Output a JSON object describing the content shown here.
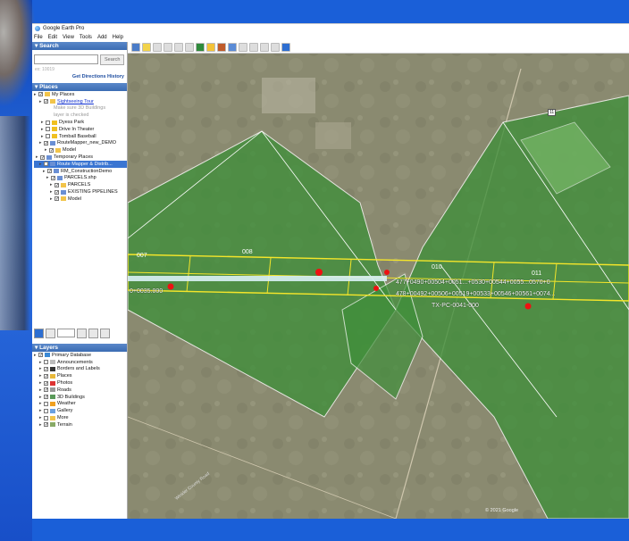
{
  "app": {
    "title": "Google Earth Pro"
  },
  "menu": [
    "File",
    "Edit",
    "View",
    "Tools",
    "Add",
    "Help"
  ],
  "search": {
    "header": "Search",
    "button": "Search",
    "hint": "ex: 10019",
    "get_directions": "Get Directions",
    "history": "History"
  },
  "places": {
    "header": "Places",
    "items": [
      {
        "label": "My Places",
        "checked": true,
        "icon": "folder-icon"
      },
      {
        "label": "Sightseeing Tour",
        "checked": true,
        "icon": "folder-icon",
        "link": true
      },
      {
        "label": "Make sure 3D Buildings",
        "sub": true
      },
      {
        "label": "layer is checked",
        "sub": true
      },
      {
        "label": "Dyess Park",
        "checked": false,
        "icon": "pin-icon"
      },
      {
        "label": "Drive In Theater",
        "checked": false,
        "icon": "pin-icon"
      },
      {
        "label": "Tomball Baseball",
        "checked": false,
        "icon": "pin-icon"
      },
      {
        "label": "RouteMapper_new_DEMO",
        "checked": true,
        "icon": "network-icon"
      },
      {
        "label": "Model",
        "checked": true,
        "icon": "folder-icon"
      },
      {
        "label": "Temporary Places",
        "checked": true,
        "icon": "network-icon"
      },
      {
        "label": "Route Mapper & Distrib...",
        "checked": true,
        "icon": "network-icon",
        "selected": true
      },
      {
        "label": "RM_ConstructionDemo",
        "checked": true,
        "icon": "network-icon"
      },
      {
        "label": "PARCELS.shp",
        "checked": true,
        "icon": "network-icon"
      },
      {
        "label": "PARCELS",
        "checked": true,
        "icon": "folder-icon"
      },
      {
        "label": "EXISTING PIPELINES",
        "checked": true,
        "icon": "network-icon"
      },
      {
        "label": "Model",
        "checked": true,
        "icon": "folder-icon"
      }
    ]
  },
  "layers": {
    "header": "Layers",
    "items": [
      {
        "label": "Primary Database",
        "checked": true,
        "icon": "globe-icon"
      },
      {
        "label": "Announcements",
        "checked": false,
        "icon": "announce-icon"
      },
      {
        "label": "Borders and Labels",
        "checked": true,
        "icon": "flag-icon"
      },
      {
        "label": "Places",
        "checked": true,
        "icon": "places-icon"
      },
      {
        "label": "Photos",
        "checked": true,
        "icon": "photo-icon"
      },
      {
        "label": "Roads",
        "checked": true,
        "icon": "roads-icon"
      },
      {
        "label": "3D Buildings",
        "checked": true,
        "icon": "buildings-icon"
      },
      {
        "label": "Weather",
        "checked": false,
        "icon": "weather-icon"
      },
      {
        "label": "Gallery",
        "checked": false,
        "icon": "gallery-icon"
      },
      {
        "label": "More",
        "checked": false,
        "icon": "more-icon"
      },
      {
        "label": "Terrain",
        "checked": true,
        "icon": "terrain-icon"
      }
    ]
  },
  "map": {
    "copyright": "© 2021 Google",
    "route_shield": "11",
    "road_name": "Winkler County Road",
    "parcels": [
      "007",
      "008",
      "010",
      "011"
    ],
    "route_labels": [
      "0+0035.000",
      "477+0490+00504+0051...+0530+00544+0055...0570+0",
      "478+00492+00506+00519+00533+00546+00561+0074...",
      "TX-PC-0041-000"
    ]
  }
}
